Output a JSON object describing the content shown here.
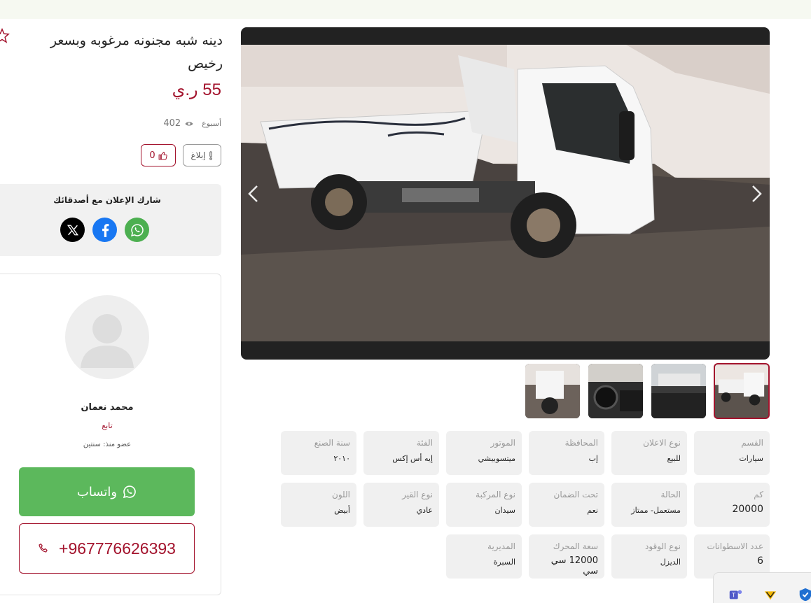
{
  "ad": {
    "title": "دينه شبه مجنونه مرغوبه وبسعر رخيص",
    "price": "55 ر.ي",
    "age": "أسبوع",
    "views": "402",
    "likes": "0",
    "report_label": "إبلاغ"
  },
  "share": {
    "title": "شارك الإعلان مع أصدقائك",
    "icons": [
      "x-icon",
      "facebook-icon",
      "whatsapp-icon"
    ]
  },
  "seller": {
    "name": "محمد نعمان",
    "follow_label": "تابع",
    "member_since": "عضو منذ: سنتين",
    "whatsapp_label": "واتساب",
    "phone": "+967776626393"
  },
  "gallery": {
    "thumbnail_count": 4,
    "active_thumbnail": 1
  },
  "specs": [
    {
      "key": "القسم",
      "value": "سيارات"
    },
    {
      "key": "نوع الاعلان",
      "value": "للبيع"
    },
    {
      "key": "المحافظة",
      "value": "إب"
    },
    {
      "key": "الموتور",
      "value": "ميتسوبيشي"
    },
    {
      "key": "الفئة",
      "value": "إيه أس إكس"
    },
    {
      "key": "سنة الصنع",
      "value": "٢٠١٠"
    },
    {
      "key": "كم",
      "value": "20000"
    },
    {
      "key": "الحالة",
      "value": "مستعمل- ممتاز"
    },
    {
      "key": "تحت الضمان",
      "value": "نعم"
    },
    {
      "key": "نوع المركبة",
      "value": "سيدان"
    },
    {
      "key": "نوع القير",
      "value": "عادي"
    },
    {
      "key": "اللون",
      "value": "أبيض"
    },
    {
      "key": "عدد الاسطوانات",
      "value": "6"
    },
    {
      "key": "نوع الوقود",
      "value": "الديزل"
    },
    {
      "key": "سعة المحرك",
      "value": "12000 سي سي"
    },
    {
      "key": "المديرية",
      "value": "السبرة"
    }
  ],
  "colors": {
    "accent": "#a3132d",
    "whatsapp": "#5cb85c",
    "facebook": "#1877f2",
    "x": "#000000"
  }
}
